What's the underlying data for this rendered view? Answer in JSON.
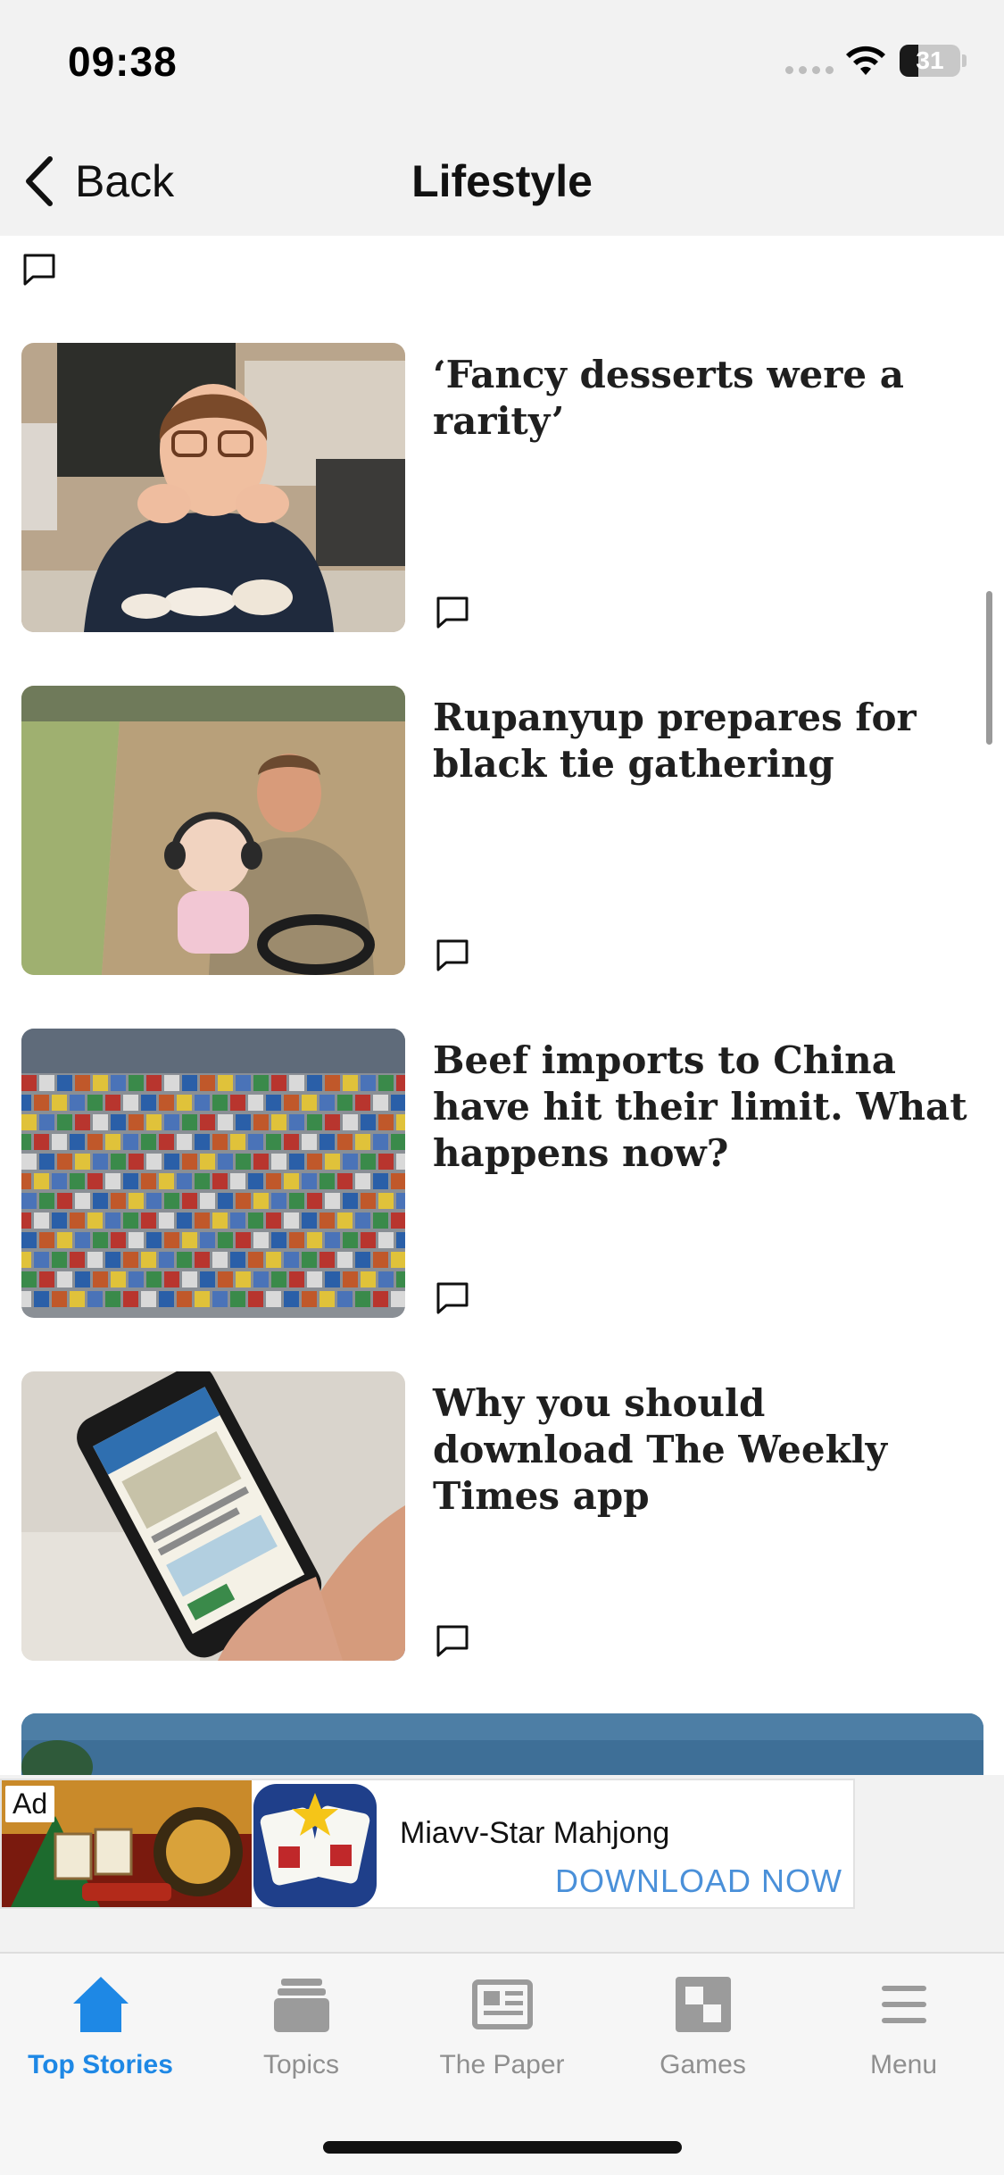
{
  "status_bar": {
    "time": "09:38",
    "battery_level": "31",
    "battery_fraction": 0.31,
    "icons": [
      "cellular-signal-icon",
      "wifi-icon",
      "battery-icon"
    ]
  },
  "nav": {
    "back_label": "Back",
    "title": "Lifestyle"
  },
  "articles": [
    {
      "headline": "‘Fancy desserts were a rarity’",
      "thumbnail": "woman-baker-photo"
    },
    {
      "headline": "Rupanyup prepares for black tie gathering",
      "thumbnail": "farmer-with-baby-photo"
    },
    {
      "headline": "Beef imports to China have hit their limit. What happens now?",
      "thumbnail": "shipping-containers-photo"
    },
    {
      "headline": "Why you should download The Weekly Times app",
      "thumbnail": "phone-app-photo"
    }
  ],
  "ad": {
    "badge": "Ad",
    "title": "Miavv-Star Mahjong",
    "cta": "DOWNLOAD NOW"
  },
  "tabs": [
    {
      "label": "Top Stories",
      "icon": "home-icon",
      "active": true
    },
    {
      "label": "Topics",
      "icon": "stack-icon",
      "active": false
    },
    {
      "label": "The Paper",
      "icon": "newspaper-icon",
      "active": false
    },
    {
      "label": "Games",
      "icon": "checkerboard-icon",
      "active": false
    },
    {
      "label": "Menu",
      "icon": "hamburger-menu-icon",
      "active": false
    }
  ],
  "colors": {
    "accent": "#1e88e5",
    "tab_inactive": "#8f8f8f",
    "ad_cta": "#4a90d9",
    "chrome_bg": "#f2f2f2"
  }
}
